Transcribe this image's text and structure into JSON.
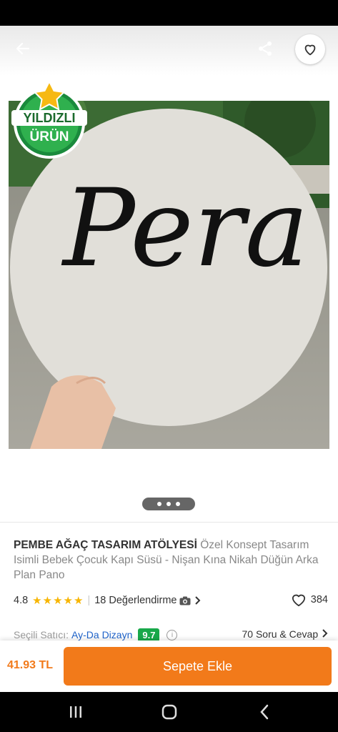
{
  "header": {
    "back_icon": "arrow-left-icon",
    "share_icon": "share-icon",
    "favorite_icon": "heart-outline-icon"
  },
  "gallery": {
    "badge_line1": "YILDIZLI",
    "badge_line2": "ÜRÜN",
    "sign_text": "Pera",
    "pager_dots": 3
  },
  "product": {
    "brand": "PEMBE AĞAÇ TASARIM ATÖLYESİ",
    "name": "Özel Konsept Tasarım Isimli Bebek Çocuk Kapı Süsü - Nişan Kına Nikah Düğün Arka Plan Pano",
    "rating": "4.8",
    "stars": 5,
    "reviews": "18 Değerlendirme",
    "favorites": "384"
  },
  "seller": {
    "label": "Seçili Satıcı:",
    "name": "Ay-Da Dizayn",
    "score": "9.7",
    "qa": "70 Soru & Cevap"
  },
  "bottom_bar": {
    "price": "41.93 TL",
    "cart_button": "Sepete Ekle"
  },
  "colors": {
    "accent": "#f27a1a",
    "star": "#f7b500",
    "seller_link": "#1e62c9",
    "score_green": "#18a84a"
  }
}
